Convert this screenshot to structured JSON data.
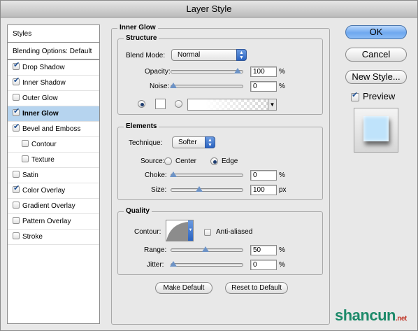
{
  "window": {
    "title": "Layer Style"
  },
  "styles_list": {
    "header": "Styles",
    "blending_options": "Blending Options: Default",
    "items": [
      {
        "label": "Drop Shadow",
        "checked": true
      },
      {
        "label": "Inner Shadow",
        "checked": true
      },
      {
        "label": "Outer Glow",
        "checked": false
      },
      {
        "label": "Inner Glow",
        "checked": true,
        "selected": true
      },
      {
        "label": "Bevel and Emboss",
        "checked": true
      },
      {
        "label": "Contour",
        "checked": false,
        "sub": true
      },
      {
        "label": "Texture",
        "checked": false,
        "sub": true
      },
      {
        "label": "Satin",
        "checked": false
      },
      {
        "label": "Color Overlay",
        "checked": true
      },
      {
        "label": "Gradient Overlay",
        "checked": false
      },
      {
        "label": "Pattern Overlay",
        "checked": false
      },
      {
        "label": "Stroke",
        "checked": false
      }
    ]
  },
  "inner_glow": {
    "title": "Inner Glow",
    "structure": {
      "title": "Structure",
      "blend_mode_label": "Blend Mode:",
      "blend_mode_value": "Normal",
      "opacity_label": "Opacity:",
      "opacity_value": "100",
      "opacity_unit": "%",
      "opacity_level": 1.0,
      "noise_label": "Noise:",
      "noise_value": "0",
      "noise_unit": "%",
      "noise_level": 0.0
    },
    "elements": {
      "title": "Elements",
      "technique_label": "Technique:",
      "technique_value": "Softer",
      "source_label": "Source:",
      "source_center": "Center",
      "source_edge": "Edge",
      "choke_label": "Choke:",
      "choke_value": "0",
      "choke_unit": "%",
      "choke_level": 0.0,
      "size_label": "Size:",
      "size_value": "100",
      "size_unit": "px",
      "size_level": 0.4
    },
    "quality": {
      "title": "Quality",
      "contour_label": "Contour:",
      "anti_aliased_label": "Anti-aliased",
      "range_label": "Range:",
      "range_value": "50",
      "range_unit": "%",
      "range_level": 0.5,
      "jitter_label": "Jitter:",
      "jitter_value": "0",
      "jitter_unit": "%",
      "jitter_level": 0.0
    },
    "make_default_label": "Make Default",
    "reset_default_label": "Reset to Default"
  },
  "actions": {
    "ok_label": "OK",
    "cancel_label": "Cancel",
    "new_style_label": "New Style...",
    "preview_label": "Preview",
    "preview_checked": true
  },
  "watermark": {
    "brand": "shancun",
    "suffix": ".net"
  },
  "colors": {
    "accent": "#6fa8ef",
    "selection": "#b6d4ef",
    "preview_tile": "#bfe3fb"
  }
}
